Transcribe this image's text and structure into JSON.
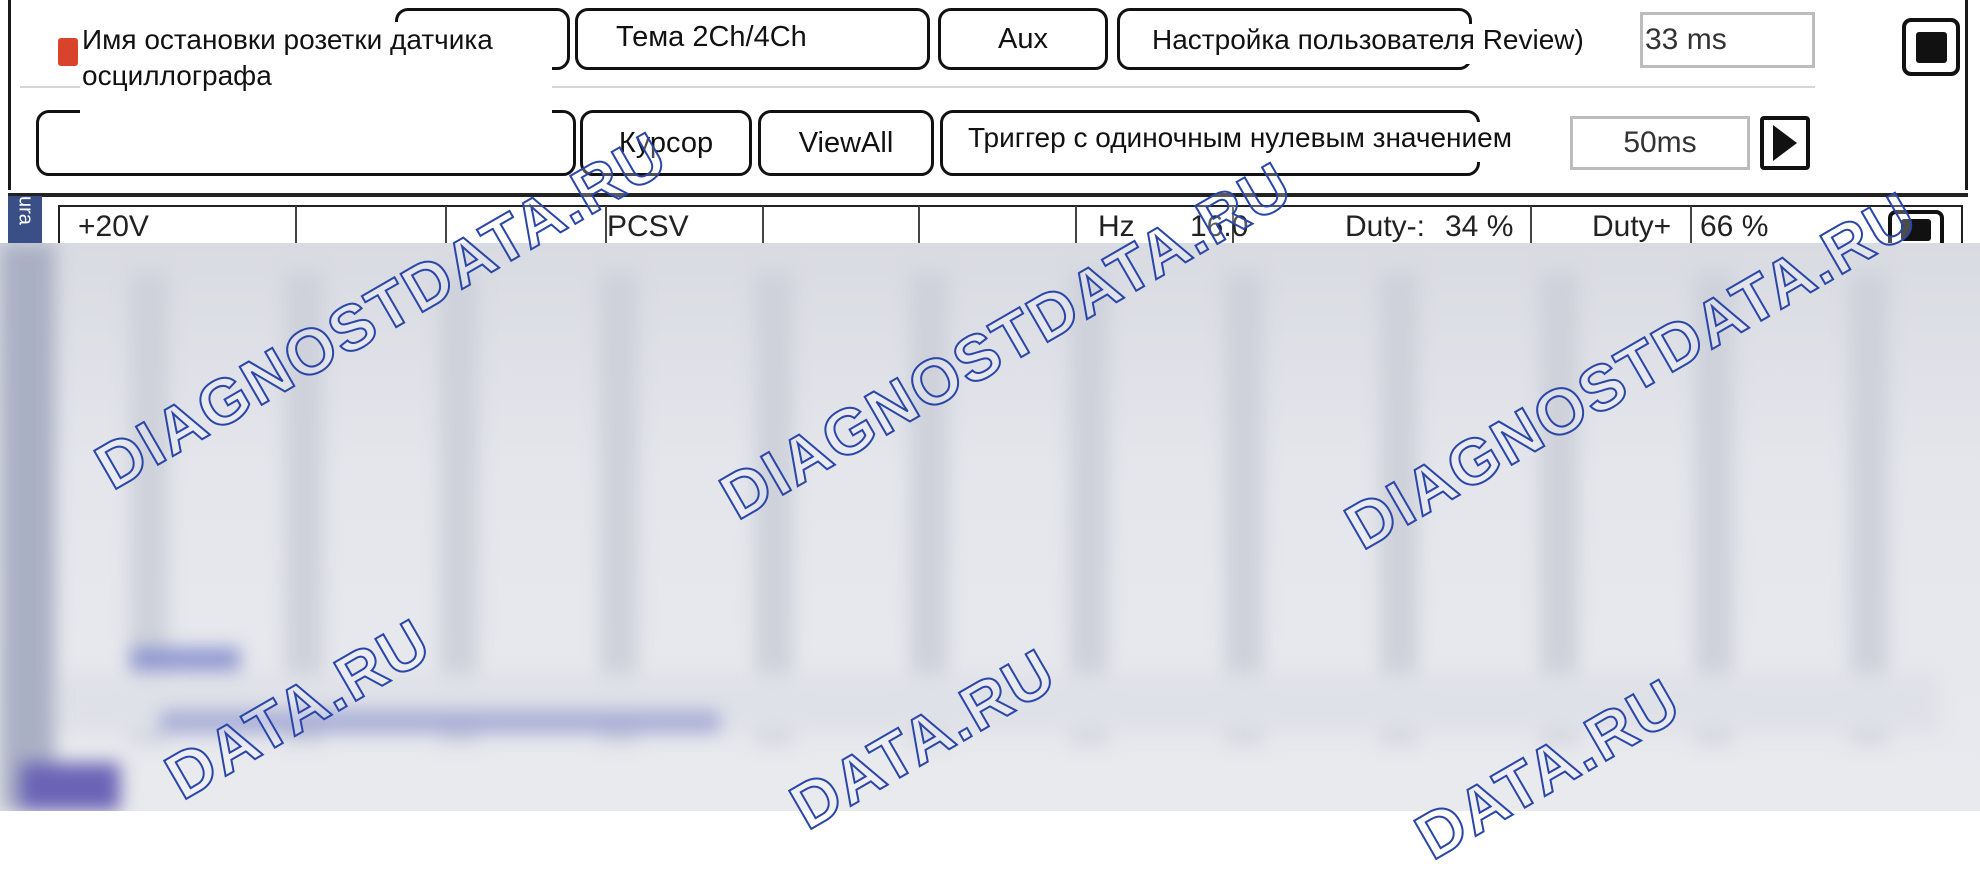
{
  "toolbar": {
    "sensor_stop_name_label": "Имя остановки розетки датчика осциллографа",
    "theme_button": "Тема 2Ch/4Ch",
    "aux_button": "Aux",
    "user_settings_button": "Настройка пользователя Review)",
    "refresh_interval_value": "33 ms",
    "cursor_button": "Курсор",
    "viewall_button": "ViewAll",
    "trigger_button": "Триггер с одиночным нулевым значением",
    "timebase_value": "50ms",
    "icons": {
      "stop": "stop-square-icon",
      "play": "play-triangle-icon",
      "marker": "red-marker-icon"
    }
  },
  "measurements": {
    "side_label": "ura",
    "voltage_scale": "+20V",
    "export_label": "PCSV",
    "hz_label": "Hz",
    "hz_value": "16.0",
    "duty_minus_label": "Duty-:",
    "duty_minus_value": "34 %",
    "duty_plus_label": "Duty+",
    "duty_plus_value": "66 %"
  },
  "watermark": {
    "text_main": "DIAGNOSTDATA.RU",
    "text_partial": "DATA.RU"
  },
  "colors": {
    "accent_marker": "#d9432c",
    "watermark_stroke": "#2946a8",
    "side_bar": "#3a4f86"
  }
}
